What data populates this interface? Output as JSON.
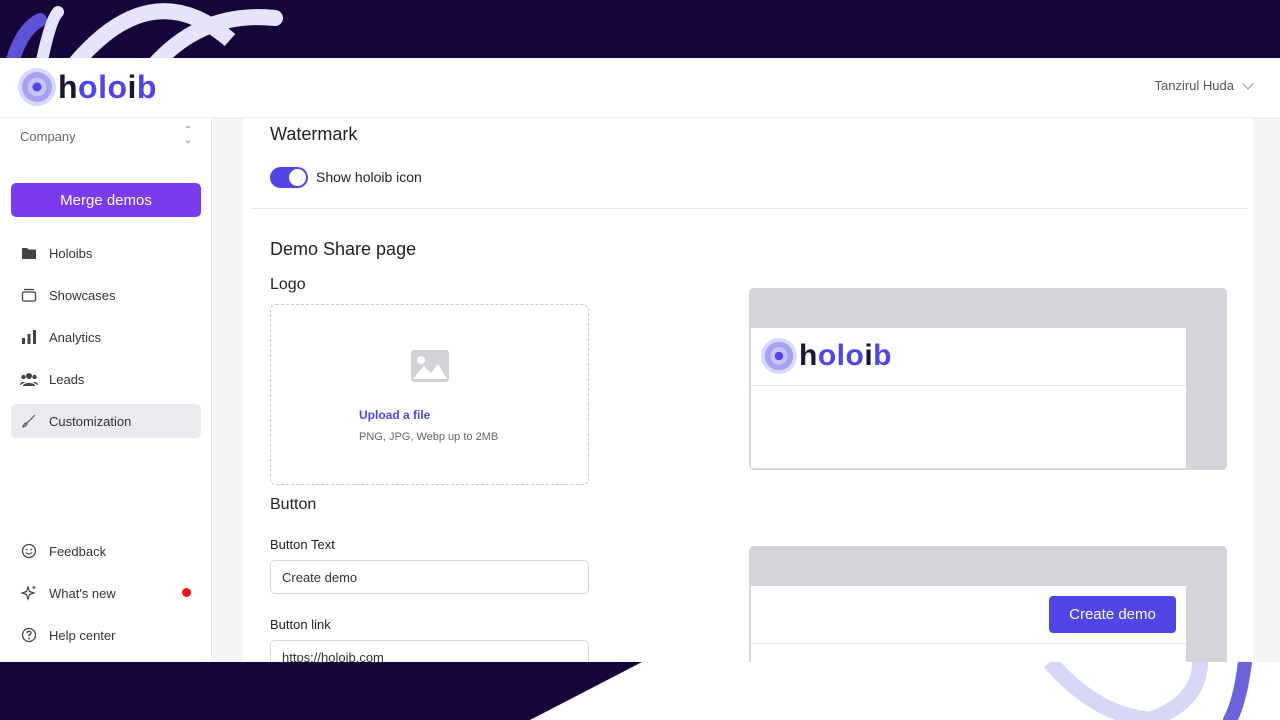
{
  "brand": {
    "part1": "h",
    "part2": "olo",
    "part3": "i",
    "part4": "b"
  },
  "header": {
    "user_name": "Tanzirul Huda"
  },
  "sidebar": {
    "company_label": "Company",
    "merge_button": "Merge demos",
    "items": [
      {
        "label": "Holoibs",
        "icon": "folder-icon"
      },
      {
        "label": "Showcases",
        "icon": "archive-icon"
      },
      {
        "label": "Analytics",
        "icon": "bar-chart-icon"
      },
      {
        "label": "Leads",
        "icon": "users-icon"
      },
      {
        "label": "Customization",
        "icon": "brush-icon",
        "active": true
      }
    ],
    "bottom_items": [
      {
        "label": "Feedback",
        "icon": "smile-icon"
      },
      {
        "label": "What's new",
        "icon": "sparkle-icon",
        "badge": true
      },
      {
        "label": "Help center",
        "icon": "help-icon"
      }
    ]
  },
  "main": {
    "watermark_title": "Watermark",
    "watermark_toggle_label": "Show holoib icon",
    "watermark_toggle_on": true,
    "share_title": "Demo Share page",
    "logo_title": "Logo",
    "upload_link": "Upload a file",
    "upload_hint": "PNG, JPG, Webp up to 2MB",
    "button_title": "Button",
    "button_text_label": "Button Text",
    "button_text_value": "Create demo",
    "button_link_label": "Button link",
    "button_link_value": "https://holoib.com"
  },
  "preview": {
    "button_label": "Create demo"
  },
  "colors": {
    "accent": "#4f46e5",
    "merge": "#7c3aed",
    "frame": "#17063a"
  }
}
